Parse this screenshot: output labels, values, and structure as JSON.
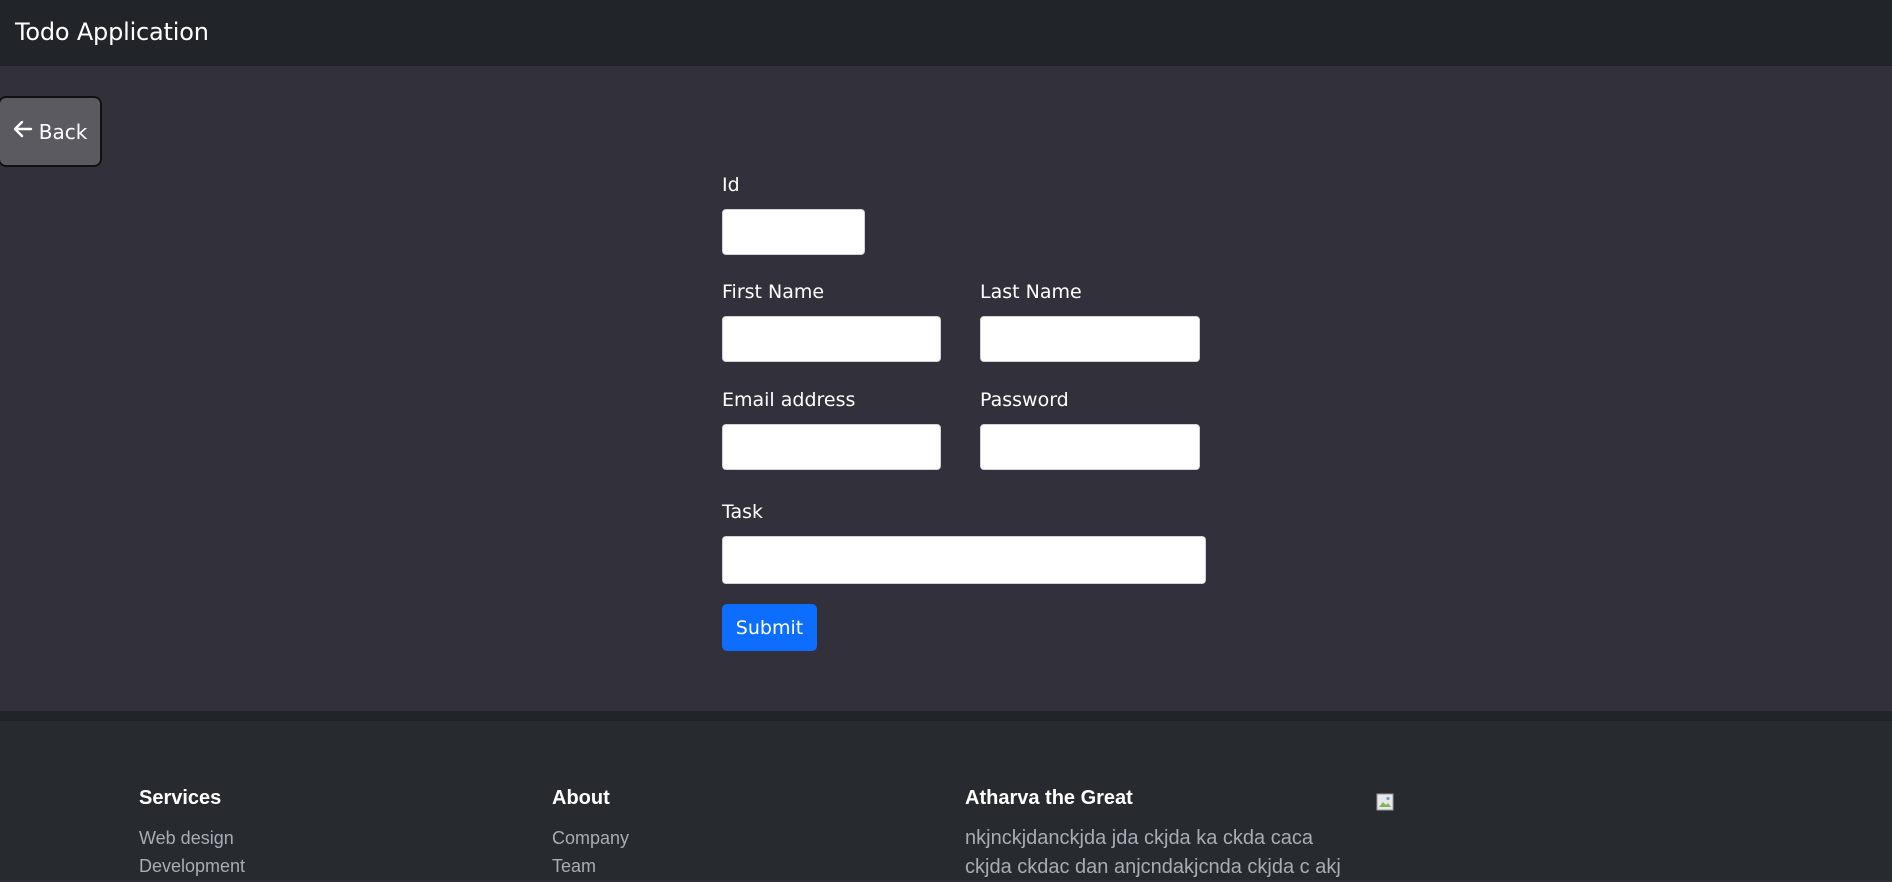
{
  "navbar": {
    "brand": "Todo Application"
  },
  "back_button": {
    "label": "Back",
    "icon": "arrow-left-icon"
  },
  "form": {
    "id_label": "Id",
    "id_value": "",
    "first_name_label": "First Name",
    "first_name_value": "",
    "last_name_label": "Last Name",
    "last_name_value": "",
    "email_label": "Email address",
    "email_value": "",
    "password_label": "Password",
    "password_value": "",
    "task_label": "Task",
    "task_value": "",
    "submit_label": "Submit"
  },
  "footer": {
    "services": {
      "heading": "Services",
      "links": [
        "Web design",
        "Development"
      ]
    },
    "about": {
      "heading": "About",
      "links": [
        "Company",
        "Team"
      ]
    },
    "brand": {
      "heading": "Atharva the Great",
      "text": "nkjnckjdanckjda jda ckjda ka ckda caca ckjda ckdac dan anjcndakjcnda ckjda c akj"
    },
    "image_icon": "broken-image-icon"
  },
  "colors": {
    "background": "#32313b",
    "navbar": "#212529",
    "footer": "#272b30",
    "primary": "#0d6efd",
    "back_button": "#5b5a60"
  }
}
